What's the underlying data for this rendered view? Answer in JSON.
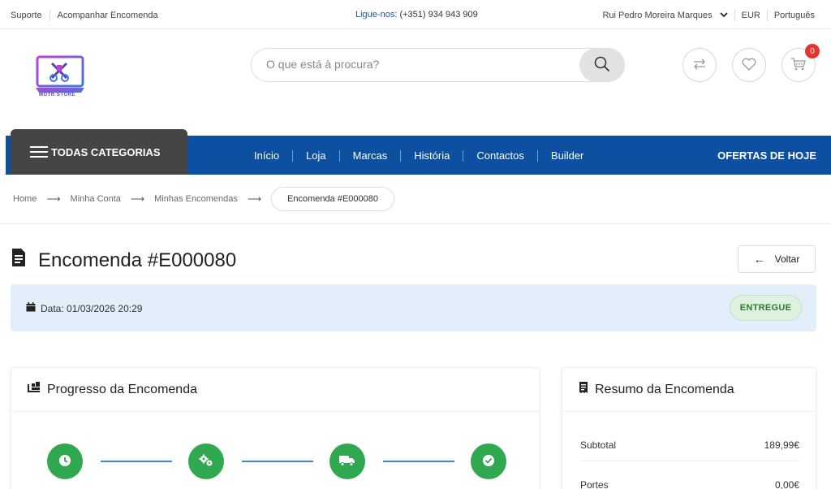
{
  "topbar": {
    "links": [
      "Suporte",
      "Acompanhar Encomenda"
    ],
    "phone_label": "Ligue-nos:",
    "phone_number": "(+351) 934 943 909",
    "user_name": "Rui Pedro Moreira Marques",
    "currency": "EUR",
    "language": "Português"
  },
  "header": {
    "logo_text": "MOTR STORE",
    "search_placeholder": "O que está à procura?",
    "cart_count": "0",
    "icons": [
      "compare-icon",
      "heart-icon",
      "cart-icon"
    ]
  },
  "nav": {
    "all_categories": "TODAS CATEGORIAS",
    "links": [
      "Início",
      "Loja",
      "Marcas",
      "História",
      "Contactos",
      "Builder"
    ],
    "deals": "OFERTAS DE HOJE"
  },
  "breadcrumb": {
    "items": [
      "Home",
      "Minha Conta",
      "Minhas Encomendas"
    ],
    "current": "Encomenda #E000080"
  },
  "order": {
    "title": "Encomenda #E000080",
    "back_label": "Voltar",
    "date": "Data: 01/03/2026 20:29",
    "status": "ENTREGUE"
  },
  "progress": {
    "title": "Progresso da Encomenda",
    "step_icons": [
      "clock-icon",
      "gears-icon",
      "truck-icon",
      "check-icon"
    ]
  },
  "summary": {
    "title": "Resumo da Encomenda",
    "rows": [
      {
        "label": "Subtotal",
        "value": "189,99€"
      },
      {
        "label": "Portes",
        "value": "0,00€"
      }
    ]
  },
  "colors": {
    "nav_blue": "#0d4fa0",
    "category_dark": "#454545",
    "step_green": "#2fa84f",
    "progress_line": "#3a86d4",
    "status_green": "#2e7d32",
    "info_bg": "#e3eefb",
    "badge_red": "#e8322f"
  }
}
